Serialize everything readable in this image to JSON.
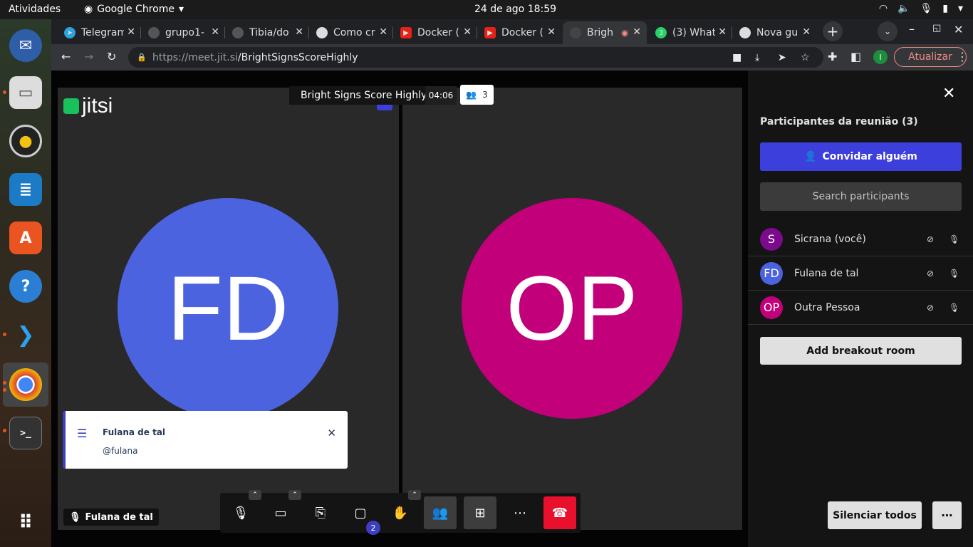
{
  "os": {
    "activities": "Atividades",
    "app_name": "Google Chrome",
    "clock": "24 de ago  18:59"
  },
  "tabs": [
    {
      "title": "Telegram",
      "fav": "#2aa3e0"
    },
    {
      "title": "grupo1-",
      "fav": "#555"
    },
    {
      "title": "Tibia/do",
      "fav": "#555"
    },
    {
      "title": "Como cr",
      "fav": "#ddd"
    },
    {
      "title": "Docker (",
      "fav": "#e62117"
    },
    {
      "title": "Docker (",
      "fav": "#e62117"
    },
    {
      "title": "Brigh",
      "fav": "#444"
    },
    {
      "title": "(3) What",
      "fav": "#25d366"
    },
    {
      "title": "Nova gu",
      "fav": "#ddd"
    }
  ],
  "browser": {
    "url_host": "https://meet.jit.si",
    "url_path": "/BrightSignsScoreHighly",
    "update_label": "Atualizar",
    "profile_initial": "I"
  },
  "meeting": {
    "logo_text": "jitsi",
    "title": "Bright Signs Score Highly",
    "timer": "04:06",
    "participant_count": "3",
    "tile1_initials": "FD",
    "tile1_color": "#4c63e0",
    "tile2_initials": "OP",
    "tile2_color": "#c2007a",
    "name_badge": "Fulana de tal",
    "chat_badge": "2"
  },
  "notification": {
    "title": "Fulana de tal",
    "subtitle": "@fulana"
  },
  "panel": {
    "title": "Participantes da reunião (3)",
    "invite_label": "Convidar alguém",
    "search_placeholder": "Search participants",
    "participants": [
      {
        "initials": "S",
        "name": "Sicrana (você)",
        "color": "#7b0a8c"
      },
      {
        "initials": "FD",
        "name": "Fulana de tal",
        "color": "#4c63e0"
      },
      {
        "initials": "OP",
        "name": "Outra Pessoa",
        "color": "#c2007a"
      }
    ],
    "breakout_label": "Add breakout room",
    "mute_all_label": "Silenciar todos",
    "more_label": "⋯"
  }
}
